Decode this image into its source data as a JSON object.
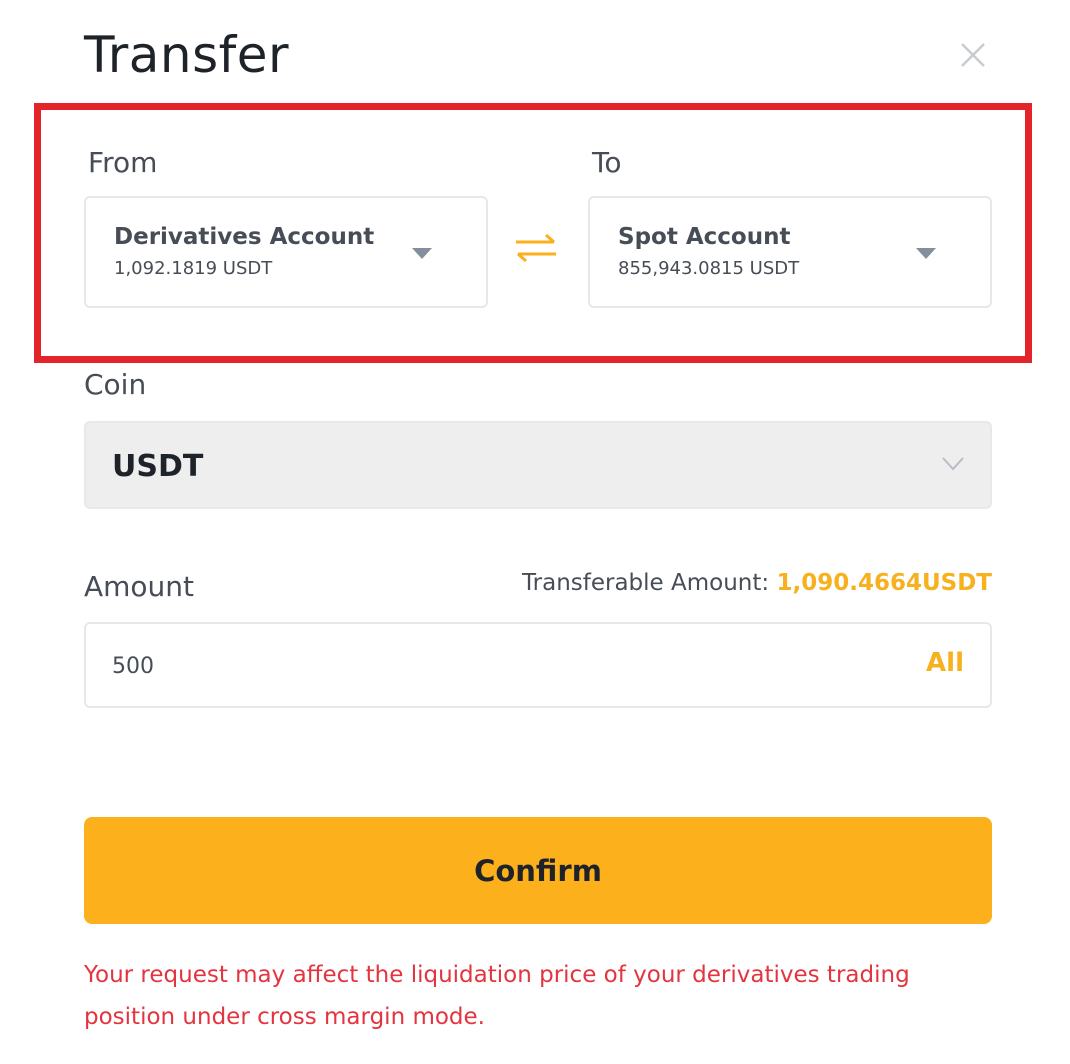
{
  "dialog": {
    "title": "Transfer",
    "close_icon": "close-icon"
  },
  "from": {
    "label": "From",
    "account_name": "Derivatives Account",
    "balance": "1,092.1819 USDT"
  },
  "to": {
    "label": "To",
    "account_name": "Spot Account",
    "balance": "855,943.0815 USDT"
  },
  "swap_icon": "swap-arrows-icon",
  "coin": {
    "label": "Coin",
    "selected": "USDT"
  },
  "amount": {
    "label": "Amount",
    "transferable_label": "Transferable Amount: ",
    "transferable_value": "1,090.4664USDT",
    "value": "500",
    "all_label": "All"
  },
  "confirm_label": "Confirm",
  "warning": "Your request may affect the liquidation price of your derivatives trading position under cross margin mode.",
  "colors": {
    "accent": "#fcb01c",
    "highlight_border": "#e3242b",
    "warning_text": "#e3343f"
  }
}
